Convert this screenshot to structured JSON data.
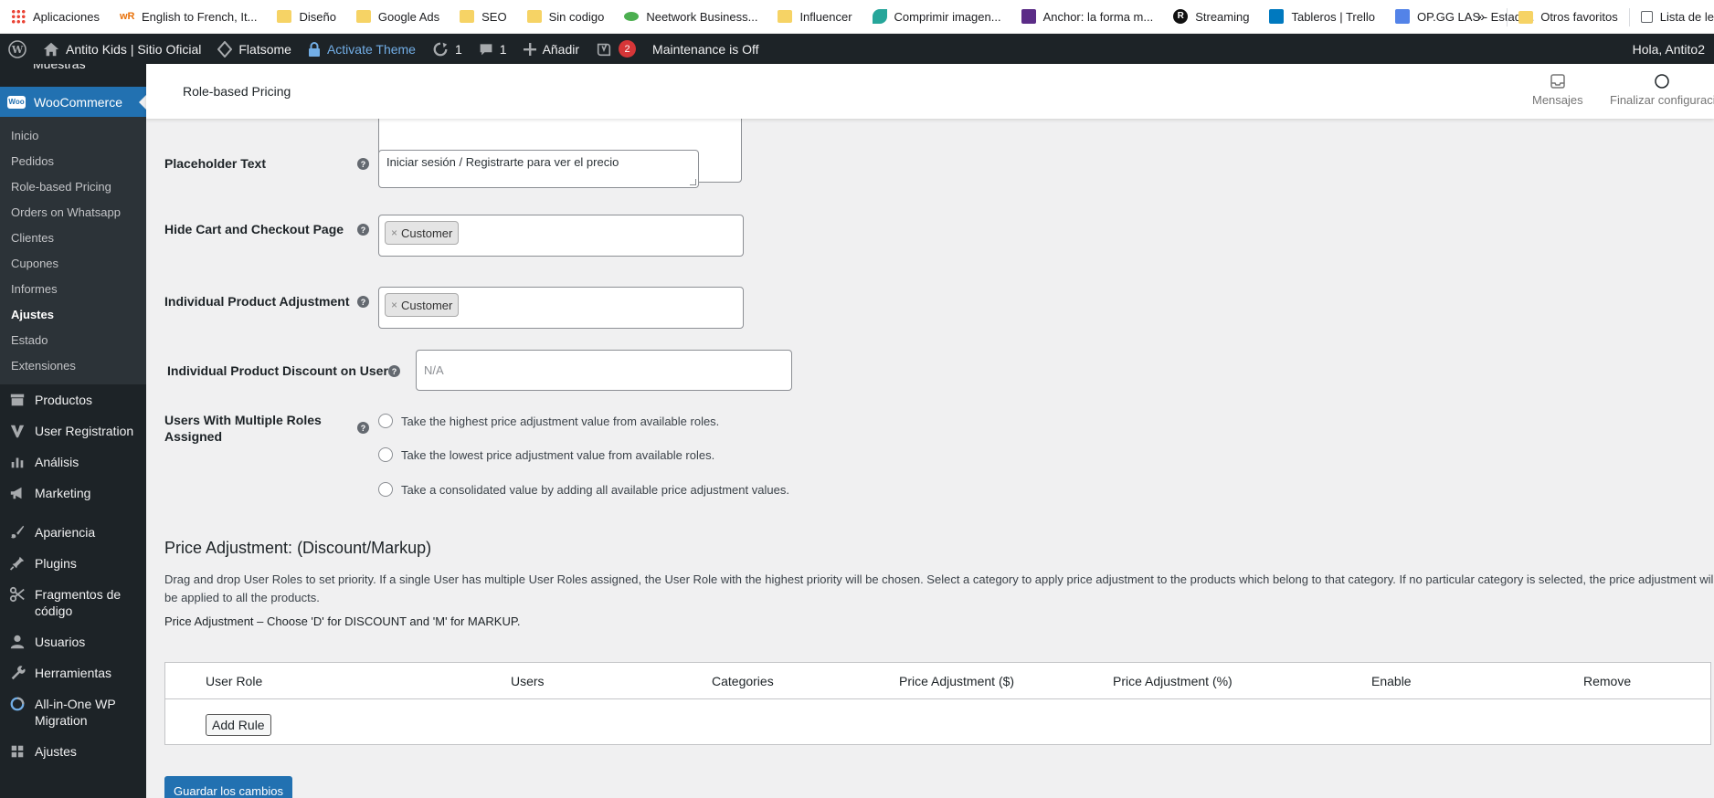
{
  "bookmarks": {
    "items": [
      {
        "label": "Aplicaciones",
        "icon": "apps-grid-icon",
        "color": "#ea4335"
      },
      {
        "label": "English to French, It...",
        "icon": "wr-icon",
        "color": "#e8710a"
      },
      {
        "label": "Diseño",
        "icon": "folder-icon",
        "color": "#f6d365"
      },
      {
        "label": "Google Ads",
        "icon": "folder-icon",
        "color": "#f6d365"
      },
      {
        "label": "SEO",
        "icon": "folder-icon",
        "color": "#f6d365"
      },
      {
        "label": "Sin codigo",
        "icon": "folder-icon",
        "color": "#f6d365"
      },
      {
        "label": "Neetwork Business...",
        "icon": "neetwork-icon",
        "color": "#4caf50"
      },
      {
        "label": "Influencer",
        "icon": "folder-icon",
        "color": "#f6d365"
      },
      {
        "label": "Comprimir imagen...",
        "icon": "leaf-icon",
        "color": "#26a69a"
      },
      {
        "label": "Anchor: la forma m...",
        "icon": "anchor-icon",
        "color": "#5b2c87"
      },
      {
        "label": "Streaming",
        "icon": "r-icon",
        "color": "#111111"
      },
      {
        "label": "Tableros | Trello",
        "icon": "trello-icon",
        "color": "#0079bf"
      },
      {
        "label": "OP.GG LAS - Estadí...",
        "icon": "opgg-icon",
        "color": "#5383e8"
      }
    ],
    "more": "»",
    "other": "Otros favoritos",
    "reading_list": "Lista de le"
  },
  "adminbar": {
    "site": "Antito Kids | Sitio Oficial",
    "theme": "Flatsome",
    "activate": "Activate Theme",
    "updates": "1",
    "comments": "1",
    "add": "Añadir",
    "yoast_count": "2",
    "maintenance": "Maintenance is Off",
    "greeting": "Hola, Antito2"
  },
  "sidebar": {
    "cut_item": "Muestras",
    "active": "WooCommerce",
    "active_icon_text": "Woo",
    "sub": [
      "Inicio",
      "Pedidos",
      "Role-based Pricing",
      "Orders on Whatsapp",
      "Clientes",
      "Cupones",
      "Informes",
      "Ajustes",
      "Estado",
      "Extensiones"
    ],
    "current_sub_index": 7,
    "menu": [
      {
        "label": "Productos",
        "icon": "products-icon"
      },
      {
        "label": "User Registration",
        "icon": "user-registration-icon"
      },
      {
        "label": "Análisis",
        "icon": "analytics-icon"
      },
      {
        "label": "Marketing",
        "icon": "megaphone-icon"
      },
      {
        "label": "Apariencia",
        "icon": "brush-icon"
      },
      {
        "label": "Plugins",
        "icon": "plugin-icon"
      },
      {
        "label": "Fragmentos de código",
        "icon": "snippets-icon"
      },
      {
        "label": "Usuarios",
        "icon": "users-icon"
      },
      {
        "label": "Herramientas",
        "icon": "tools-icon"
      },
      {
        "label": "All-in-One WP Migration",
        "icon": "migration-icon"
      },
      {
        "label": "Ajustes",
        "icon": "settings-icon"
      }
    ]
  },
  "header": {
    "title": "Role-based Pricing",
    "messages": "Mensajes",
    "finish": "Finalizar configuraci"
  },
  "form": {
    "placeholder_label": "Placeholder Text",
    "placeholder_value": "Iniciar sesión / Registrarte para ver el precio",
    "hide_cart_label": "Hide Cart and Checkout Page",
    "hide_cart_chip": "Customer",
    "individual_adj_label": "Individual Product Adjustment",
    "individual_adj_chip": "Customer",
    "discount_users_label": "Individual Product Discount on Users",
    "discount_users_placeholder": "N/A",
    "multi_roles_label_1": "Users With Multiple Roles",
    "multi_roles_label_2": "Assigned",
    "radios": [
      "Take the highest price adjustment value from available roles.",
      "Take the lowest price adjustment value from available roles.",
      "Take a consolidated value by adding all available price adjustment values."
    ],
    "chip_remove": "×",
    "help": "?"
  },
  "price_adjustment": {
    "title": "Price Adjustment: (Discount/Markup)",
    "description": "Drag and drop User Roles to set priority. If a single User has multiple User Roles assigned, the User Role with the highest priority will be chosen. Select a category to apply price adjustment to the products which belong to that category. If no particular category is selected, the price adjustment will be applied to all the products.",
    "note": "Price Adjustment – Choose 'D' for DISCOUNT and 'M' for MARKUP.",
    "columns": [
      "User Role",
      "Users",
      "Categories",
      "Price Adjustment ($)",
      "Price Adjustment (%)",
      "Enable",
      "Remove"
    ],
    "add_rule": "Add Rule"
  },
  "save_button": "Guardar los cambios",
  "colors": {
    "admin_bg": "#1d2327",
    "accent": "#2271b1",
    "badge": "#d63638",
    "link": "#72aee6"
  }
}
